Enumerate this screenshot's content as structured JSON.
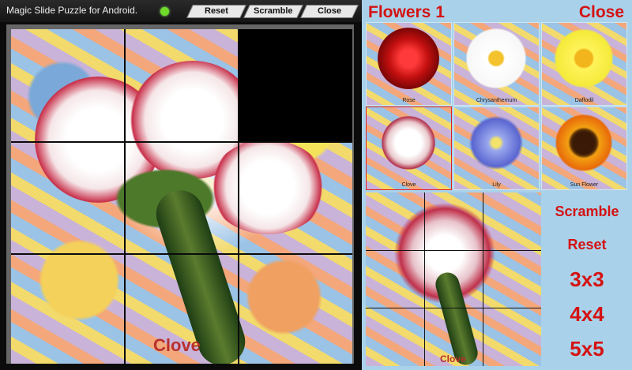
{
  "topbar": {
    "title": "Magic Slide Puzzle for Android.",
    "reset_label": "Reset",
    "scramble_label": "Scramble",
    "close_label": "Close",
    "status_color": "#6fdc2a"
  },
  "board": {
    "caption": "Clove",
    "grid": "3x3",
    "blank_tile": "top-right"
  },
  "panel": {
    "title": "Flowers 1",
    "close_label": "Close",
    "thumbnails": [
      {
        "label": "Rose"
      },
      {
        "label": "Chrysanthemum"
      },
      {
        "label": "Daffodil"
      },
      {
        "label": "Clove"
      },
      {
        "label": "Lily"
      },
      {
        "label": "Sun Flower"
      }
    ],
    "preview_caption": "Clove",
    "buttons": {
      "scramble": "Scramble",
      "reset": "Reset",
      "size3": "3x3",
      "size4": "4x4",
      "size5": "5x5"
    },
    "accent_color": "#d41212",
    "background_color": "#a9d2ea"
  }
}
